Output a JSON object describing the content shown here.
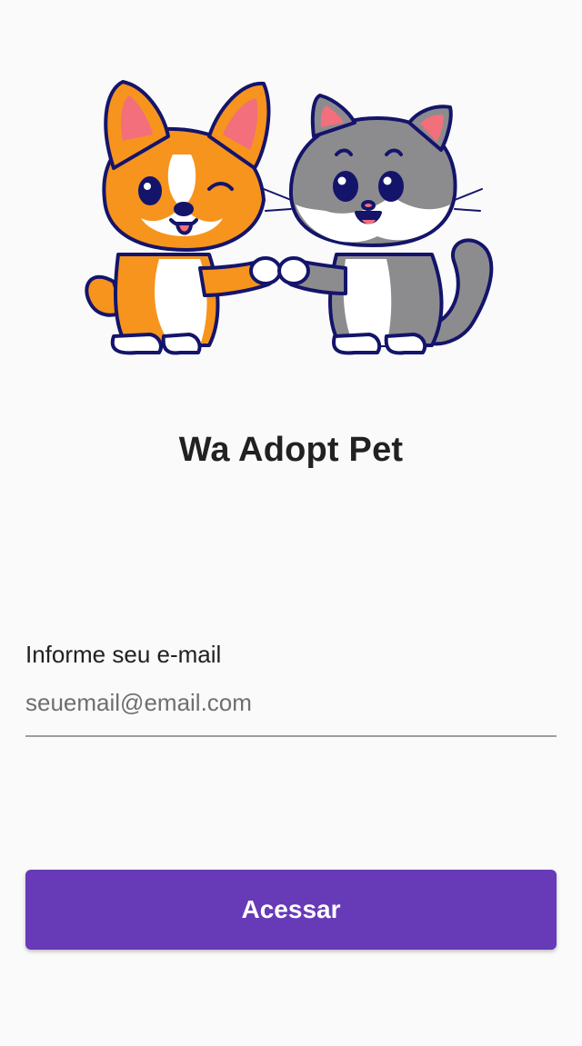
{
  "hero": {
    "illustration": "dog-and-cat-fist-bump-illustration"
  },
  "app": {
    "title": "Wa Adopt Pet"
  },
  "login": {
    "email_label": "Informe seu e-mail",
    "email_placeholder": "seuemail@email.com",
    "email_value": "",
    "submit_label": "Acessar"
  },
  "colors": {
    "background": "#fafafa",
    "primary": "#673ab7",
    "text": "#212121",
    "dog_orange": "#f7941d",
    "cat_gray": "#8c8c8f",
    "outline": "#14146b"
  }
}
